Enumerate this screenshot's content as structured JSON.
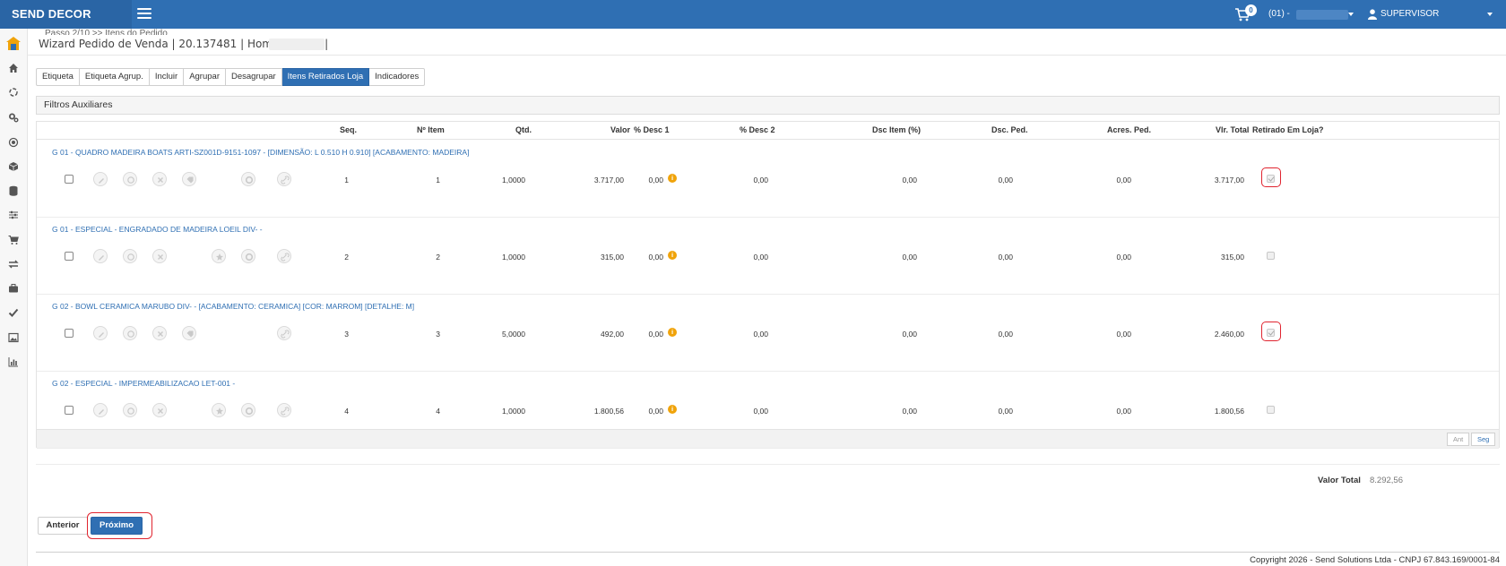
{
  "topbar": {
    "brand": "SEND DECOR",
    "cart_count": "0",
    "store": "(01) -",
    "user": "SUPERVISOR (SUPERVISOR)"
  },
  "sidebar": {
    "icons": [
      "logo-icon",
      "home-icon",
      "refresh-icon",
      "cogs-icon",
      "target-icon",
      "cube-icon",
      "database-icon",
      "sliders-icon",
      "cart-icon",
      "exchange-icon",
      "briefcase-icon",
      "check-icon",
      "image-icon",
      "bar-chart-icon"
    ]
  },
  "header": {
    "ghost": "Passo 2/10 >> Itens do Pedido",
    "title": "Wizard Pedido de Venda | 20.137481 | Homologação |"
  },
  "tabs": [
    "Etiqueta",
    "Etiqueta Agrup.",
    "Incluir",
    "Agrupar",
    "Desagrupar",
    "Itens Retirados Loja",
    "Indicadores"
  ],
  "active_tab": 5,
  "filters": {
    "label": "Filtros Auxiliares"
  },
  "columns": {
    "seq": "Seq.",
    "item": "Nº Item",
    "qtd": "Qtd.",
    "valor": "Valor",
    "desc1": "% Desc 1",
    "desc2": "% Desc 2",
    "dsc_item": "Dsc Item (%)",
    "dsc_ped": "Dsc. Ped.",
    "acres": "Acres. Ped.",
    "total": "Vlr. Total",
    "retirado": "Retirado Em Loja?"
  },
  "rows": [
    {
      "title": "G 01 - QUADRO MADEIRA BOATS ARTI-SZ001D-9151-1097 - [DIMENSÃO: L 0.510 H 0.910] [ACABAMENTO: MADEIRA]",
      "seq": "1",
      "item": "1",
      "qtd": "1,0000",
      "valor": "3.717,00",
      "desc1": "0,00",
      "desc2": "0,00",
      "dsc_item": "0,00",
      "dsc_ped": "0,00",
      "acres": "0,00",
      "total": "3.717,00",
      "retirado": true,
      "highlight": true
    },
    {
      "title": "G 01 - ESPECIAL - ENGRADADO DE MADEIRA LOEIL DIV- -",
      "seq": "2",
      "item": "2",
      "qtd": "1,0000",
      "valor": "315,00",
      "desc1": "0,00",
      "desc2": "0,00",
      "dsc_item": "0,00",
      "dsc_ped": "0,00",
      "acres": "0,00",
      "total": "315,00",
      "retirado": false,
      "highlight": false
    },
    {
      "title": "G 02 - BOWL CERAMICA MARUBO DIV- - [ACABAMENTO: CERAMICA] [COR: MARROM] [DETALHE: M]",
      "seq": "3",
      "item": "3",
      "qtd": "5,0000",
      "valor": "492,00",
      "desc1": "0,00",
      "desc2": "0,00",
      "dsc_item": "0,00",
      "dsc_ped": "0,00",
      "acres": "0,00",
      "total": "2.460,00",
      "retirado": true,
      "highlight": true
    },
    {
      "title": "G 02 - ESPECIAL - IMPERMEABILIZACAO LET-001 -",
      "seq": "4",
      "item": "4",
      "qtd": "1,0000",
      "valor": "1.800,56",
      "desc1": "0,00",
      "desc2": "0,00",
      "dsc_item": "0,00",
      "dsc_ped": "0,00",
      "acres": "0,00",
      "total": "1.800,56",
      "retirado": false,
      "highlight": false
    }
  ],
  "pager": {
    "prev": "Ant",
    "next": "Seg"
  },
  "totals": {
    "label": "Valor Total",
    "value": "8.292,56"
  },
  "buttons": {
    "prev": "Anterior",
    "next": "Próximo"
  },
  "copyright": "Copyright 2026 - Send Solutions Ltda - CNPJ 67.843.169/0001-84",
  "colors": {
    "primary": "#2f6fb3",
    "highlight": "#e0242f",
    "info": "#f0a30a"
  }
}
